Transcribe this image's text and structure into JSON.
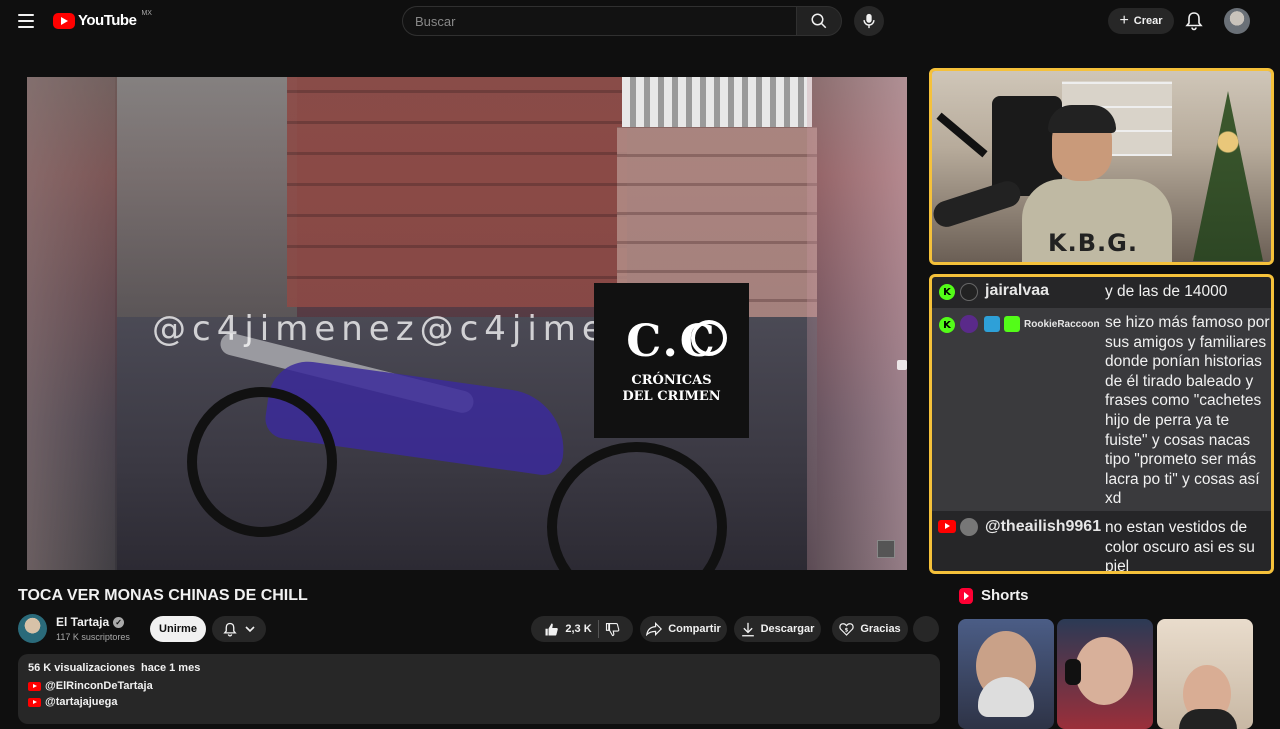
{
  "header": {
    "logo_text": "YouTube",
    "country_code": "MX",
    "search_placeholder": "Buscar",
    "create_label": "Crear"
  },
  "video": {
    "watermark_text": "@c4jimenez@c4jimenez",
    "logo_big": "C.C",
    "logo_sub_line1": "CRÓNICAS",
    "logo_sub_line2": "DEL CRIMEN"
  },
  "webcam": {
    "shirt_text": "K.B.G."
  },
  "chat": {
    "messages": [
      {
        "platform": "kick",
        "user": "jairalvaa",
        "text": "y de las de 14000"
      },
      {
        "platform": "kick",
        "user": "RookieRaccoon",
        "text": "se hizo más famoso por sus amigos y familiares donde ponían historias de él tirado baleado y frases como \"cachetes hijo de perra ya te fuiste\" y cosas nacas tipo \"prometo ser más lacra po ti\" y cosas así xd"
      },
      {
        "platform": "youtube",
        "user": "@theailish9961",
        "text": "no estan vestidos de color oscuro asi es su piel"
      }
    ]
  },
  "title": "TOCA VER MONAS CHINAS DE CHILL",
  "channel": {
    "name": "El Tartaja",
    "subscribers": "117 K suscriptores",
    "join_label": "Unirme"
  },
  "actions": {
    "likes": "2,3 K",
    "share": "Compartir",
    "download": "Descargar",
    "thanks": "Gracias"
  },
  "description": {
    "views": "56 K visualizaciones",
    "age": "hace 1 mes",
    "link1": "@ElRinconDeTartaja",
    "link2": "@tartajajuega"
  },
  "shorts": {
    "heading": "Shorts"
  },
  "colors": {
    "background": "#0f0f0f",
    "overlay_border": "#f5c13a",
    "youtube_red": "#ff0000",
    "kick_green": "#53fc18"
  }
}
